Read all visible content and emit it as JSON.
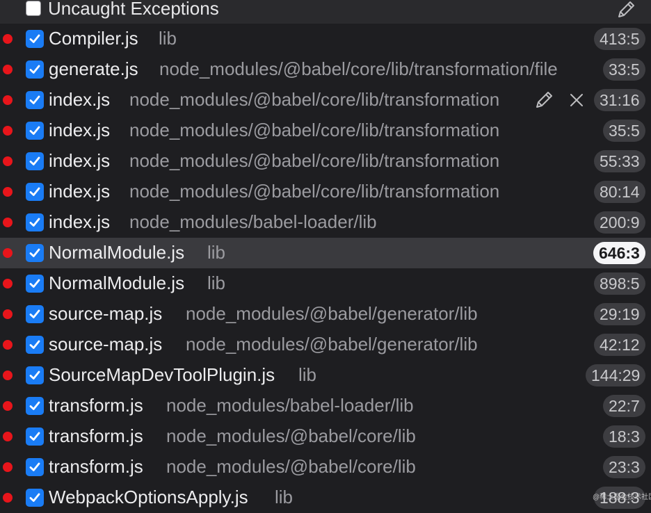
{
  "header": {
    "label": "Uncaught Exceptions",
    "checked": false,
    "edit_icon": "pencil-icon"
  },
  "breakpoints": [
    {
      "file": "Compiler.js",
      "path": "lib",
      "location": "413:5",
      "enabled": true
    },
    {
      "file": "generate.js",
      "path": "node_modules/@babel/core/lib/transformation/file",
      "location": "33:5",
      "enabled": true
    },
    {
      "file": "index.js",
      "path": "node_modules/@babel/core/lib/transformation",
      "location": "31:16",
      "enabled": true,
      "hovered": true
    },
    {
      "file": "index.js",
      "path": "node_modules/@babel/core/lib/transformation",
      "location": "35:5",
      "enabled": true
    },
    {
      "file": "index.js",
      "path": "node_modules/@babel/core/lib/transformation",
      "location": "55:33",
      "enabled": true
    },
    {
      "file": "index.js",
      "path": "node_modules/@babel/core/lib/transformation",
      "location": "80:14",
      "enabled": true
    },
    {
      "file": "index.js",
      "path": "node_modules/babel-loader/lib",
      "location": "200:9",
      "enabled": true
    },
    {
      "file": "NormalModule.js",
      "path": "lib",
      "location": "646:3",
      "enabled": true,
      "selected": true
    },
    {
      "file": "NormalModule.js",
      "path": "lib",
      "location": "898:5",
      "enabled": true
    },
    {
      "file": "source-map.js",
      "path": "node_modules/@babel/generator/lib",
      "location": "29:19",
      "enabled": true
    },
    {
      "file": "source-map.js",
      "path": "node_modules/@babel/generator/lib",
      "location": "42:12",
      "enabled": true
    },
    {
      "file": "SourceMapDevToolPlugin.js",
      "path": "lib",
      "location": "144:29",
      "enabled": true
    },
    {
      "file": "transform.js",
      "path": "node_modules/babel-loader/lib",
      "location": "22:7",
      "enabled": true
    },
    {
      "file": "transform.js",
      "path": "node_modules/@babel/core/lib",
      "location": "18:3",
      "enabled": true
    },
    {
      "file": "transform.js",
      "path": "node_modules/@babel/core/lib",
      "location": "23:3",
      "enabled": true
    },
    {
      "file": "WebpackOptionsApply.js",
      "path": "lib",
      "location": "188:3",
      "enabled": true
    }
  ],
  "hover_actions": {
    "edit_icon": "pencil-icon",
    "remove_icon": "close-icon"
  },
  "watermark": "@稀土掘金技术社区",
  "colors": {
    "background": "#1e1e21",
    "header_background": "#2a2a2d",
    "selected_row": "#3a3a3e",
    "breakpoint_dot": "#e8151b",
    "checkbox": "#1a7cf5",
    "path_text": "#9b9ba0",
    "badge": "#3d3d41"
  }
}
